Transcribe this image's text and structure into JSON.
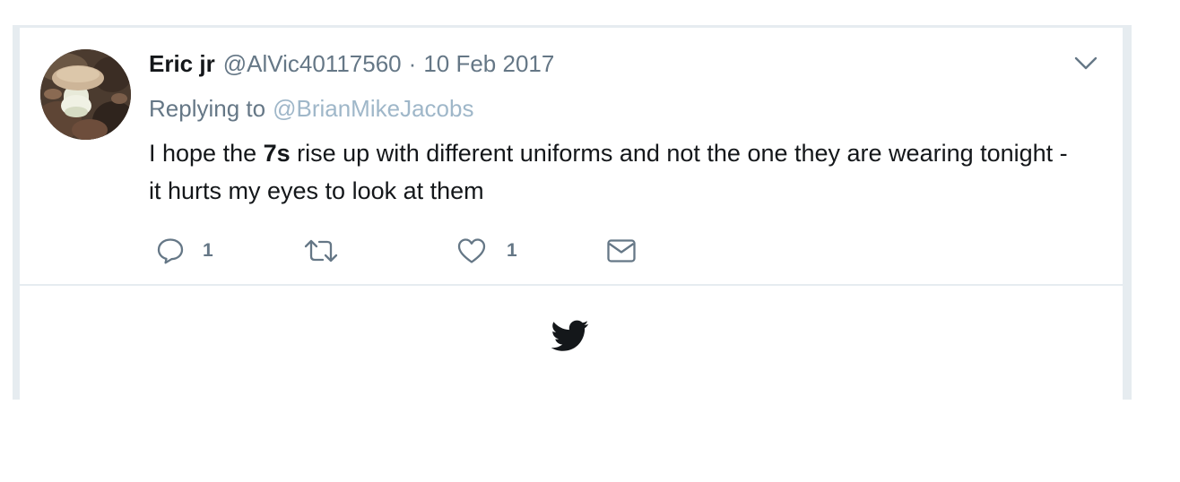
{
  "tweet": {
    "display_name": "Eric jr",
    "handle": "@AlVic40117560",
    "separator": "·",
    "date": "10 Feb 2017",
    "replying_label": "Replying to",
    "replying_to": "@BrianMikeJacobs",
    "text_before": "I hope the ",
    "text_bold": "7s",
    "text_after": " rise up with different uniforms and not the one they are wearing tonight - it hurts my eyes to look at them"
  },
  "actions": {
    "reply": {
      "icon": "reply-icon",
      "count": "1"
    },
    "retweet": {
      "icon": "retweet-icon",
      "count": ""
    },
    "like": {
      "icon": "heart-icon",
      "count": "1"
    },
    "message": {
      "icon": "envelope-icon"
    }
  },
  "menu": {
    "icon": "chevron-down-icon"
  },
  "footer": {
    "icon": "twitter-bird-icon"
  },
  "colors": {
    "text_primary": "#14171a",
    "text_secondary": "#657786",
    "mention": "#9fb7c9",
    "border": "#e6ecf0",
    "icon": "#657786",
    "bird": "#14171a"
  }
}
